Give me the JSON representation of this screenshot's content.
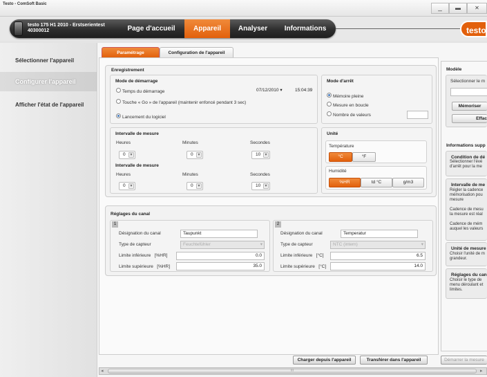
{
  "window": {
    "title": "Testo - ComSoft Basic",
    "minimize": "_",
    "maximize": "▬",
    "close": "✕"
  },
  "device": {
    "name_line1": "testo 175 H1 2010 - Erstserientest",
    "name_line2": "40300012"
  },
  "nav": {
    "tabs": [
      {
        "label": "Page d'accueil"
      },
      {
        "label": "Appareil"
      },
      {
        "label": "Analyser"
      },
      {
        "label": "Informations"
      }
    ],
    "active": "Appareil"
  },
  "brand": {
    "logo": "testo",
    "color": "#e2600c"
  },
  "sidebar": {
    "items": [
      {
        "label": "Sélectionner l'appareil"
      },
      {
        "label": "Configurer l'appareil"
      },
      {
        "label": "Afficher l'état de l'appareil"
      }
    ]
  },
  "subtabs": [
    {
      "label": "Paramétrage"
    },
    {
      "label": "Configuration de l'appareil"
    }
  ],
  "enregistrement": {
    "title": "Enregistrement",
    "start_mode": {
      "title": "Mode de démarrage",
      "options": [
        {
          "label": "Temps du démarrage",
          "selected": false
        },
        {
          "label": "Touche « Go » de l'appareil (maintenir enfoncé pendant 3 sec)",
          "selected": false
        },
        {
          "label": "Lancement du logiciel",
          "selected": true
        }
      ],
      "date": "07/12/2010",
      "time": "15:04:39"
    },
    "stop_mode": {
      "title": "Mode d'arrêt",
      "options": [
        {
          "label": "Mémoire pleine",
          "selected": true
        },
        {
          "label": "Mesure en boucle",
          "selected": false
        },
        {
          "label": "Nombre de valeurs",
          "selected": false
        }
      ],
      "count_value": ""
    },
    "interval1": {
      "title": "Intervalle de mesure",
      "heures_label": "Heures",
      "minutes_label": "Minutes",
      "secondes_label": "Secondes",
      "heures": "0",
      "minutes": "0",
      "secondes": "10"
    },
    "interval2": {
      "title": "Intervalle de mesure",
      "heures_label": "Heures",
      "minutes_label": "Minutes",
      "secondes_label": "Secondes",
      "heures": "0",
      "minutes": "0",
      "secondes": "10"
    },
    "unit": {
      "title": "Unité",
      "temp_label": "Température",
      "temp_options": [
        "°C",
        "°F"
      ],
      "temp_selected": "°C",
      "hum_label": "Humidité",
      "hum_options": [
        "%HR",
        "td °C",
        "g/m3"
      ],
      "hum_selected": "%HR"
    }
  },
  "channels": {
    "title": "Réglages du canal",
    "list": [
      {
        "num": "1",
        "designation_label": "Désignation du canal",
        "designation": "Taupunkt",
        "sensor_label": "Type de capteur",
        "sensor": "Feuchtefühler",
        "low_label": "Limite inférieure",
        "low_unit": "[%HR]",
        "low": "0.0",
        "high_label": "Limite supérieure",
        "high_unit": "[%HR]",
        "high": "35.0"
      },
      {
        "num": "2",
        "designation_label": "Désignation du canal",
        "designation": "Temperatur",
        "sensor_label": "Type de capteur",
        "sensor": "NTC (intern)",
        "low_label": "Limite inférieure",
        "low_unit": "[°C]",
        "low": "6.5",
        "high_label": "Limite supérieure",
        "high_unit": "[°C]",
        "high": "14.0"
      }
    ]
  },
  "model": {
    "title": "Modèle",
    "select_label": "Sélectionner le m",
    "save_btn": "Mémoriser",
    "delete_btn": "Effac"
  },
  "info": {
    "title": "Informations supp",
    "sections": [
      {
        "title": "Condition de dé",
        "lines": [
          "Sélectionner l'évé",
          "d'arrêt pour la me"
        ]
      },
      {
        "title": "Intervalle de me",
        "lines": [
          "Régler la cadence",
          "mémorisation pou",
          "mesure",
          "",
          "Cadence de mesu",
          "la mesure est réal",
          "",
          "Cadence de mém",
          "auquel les valeurs"
        ]
      },
      {
        "title": "Unité de mesure",
        "lines": [
          "Choisir l'unité de m",
          "grandeur."
        ]
      },
      {
        "title": "Réglages du can",
        "lines": [
          "Choisir le type de",
          "menu déroulant et",
          "limites."
        ]
      }
    ]
  },
  "bottom": {
    "load_btn": "Charger depuis l'appareil",
    "transfer_btn": "Transférer dans l'appareil",
    "start_btn": "Démarrer la mesure"
  },
  "scrollbar": {
    "left_arrow": "◂",
    "right_arrow": "▸",
    "thumb": "III"
  }
}
